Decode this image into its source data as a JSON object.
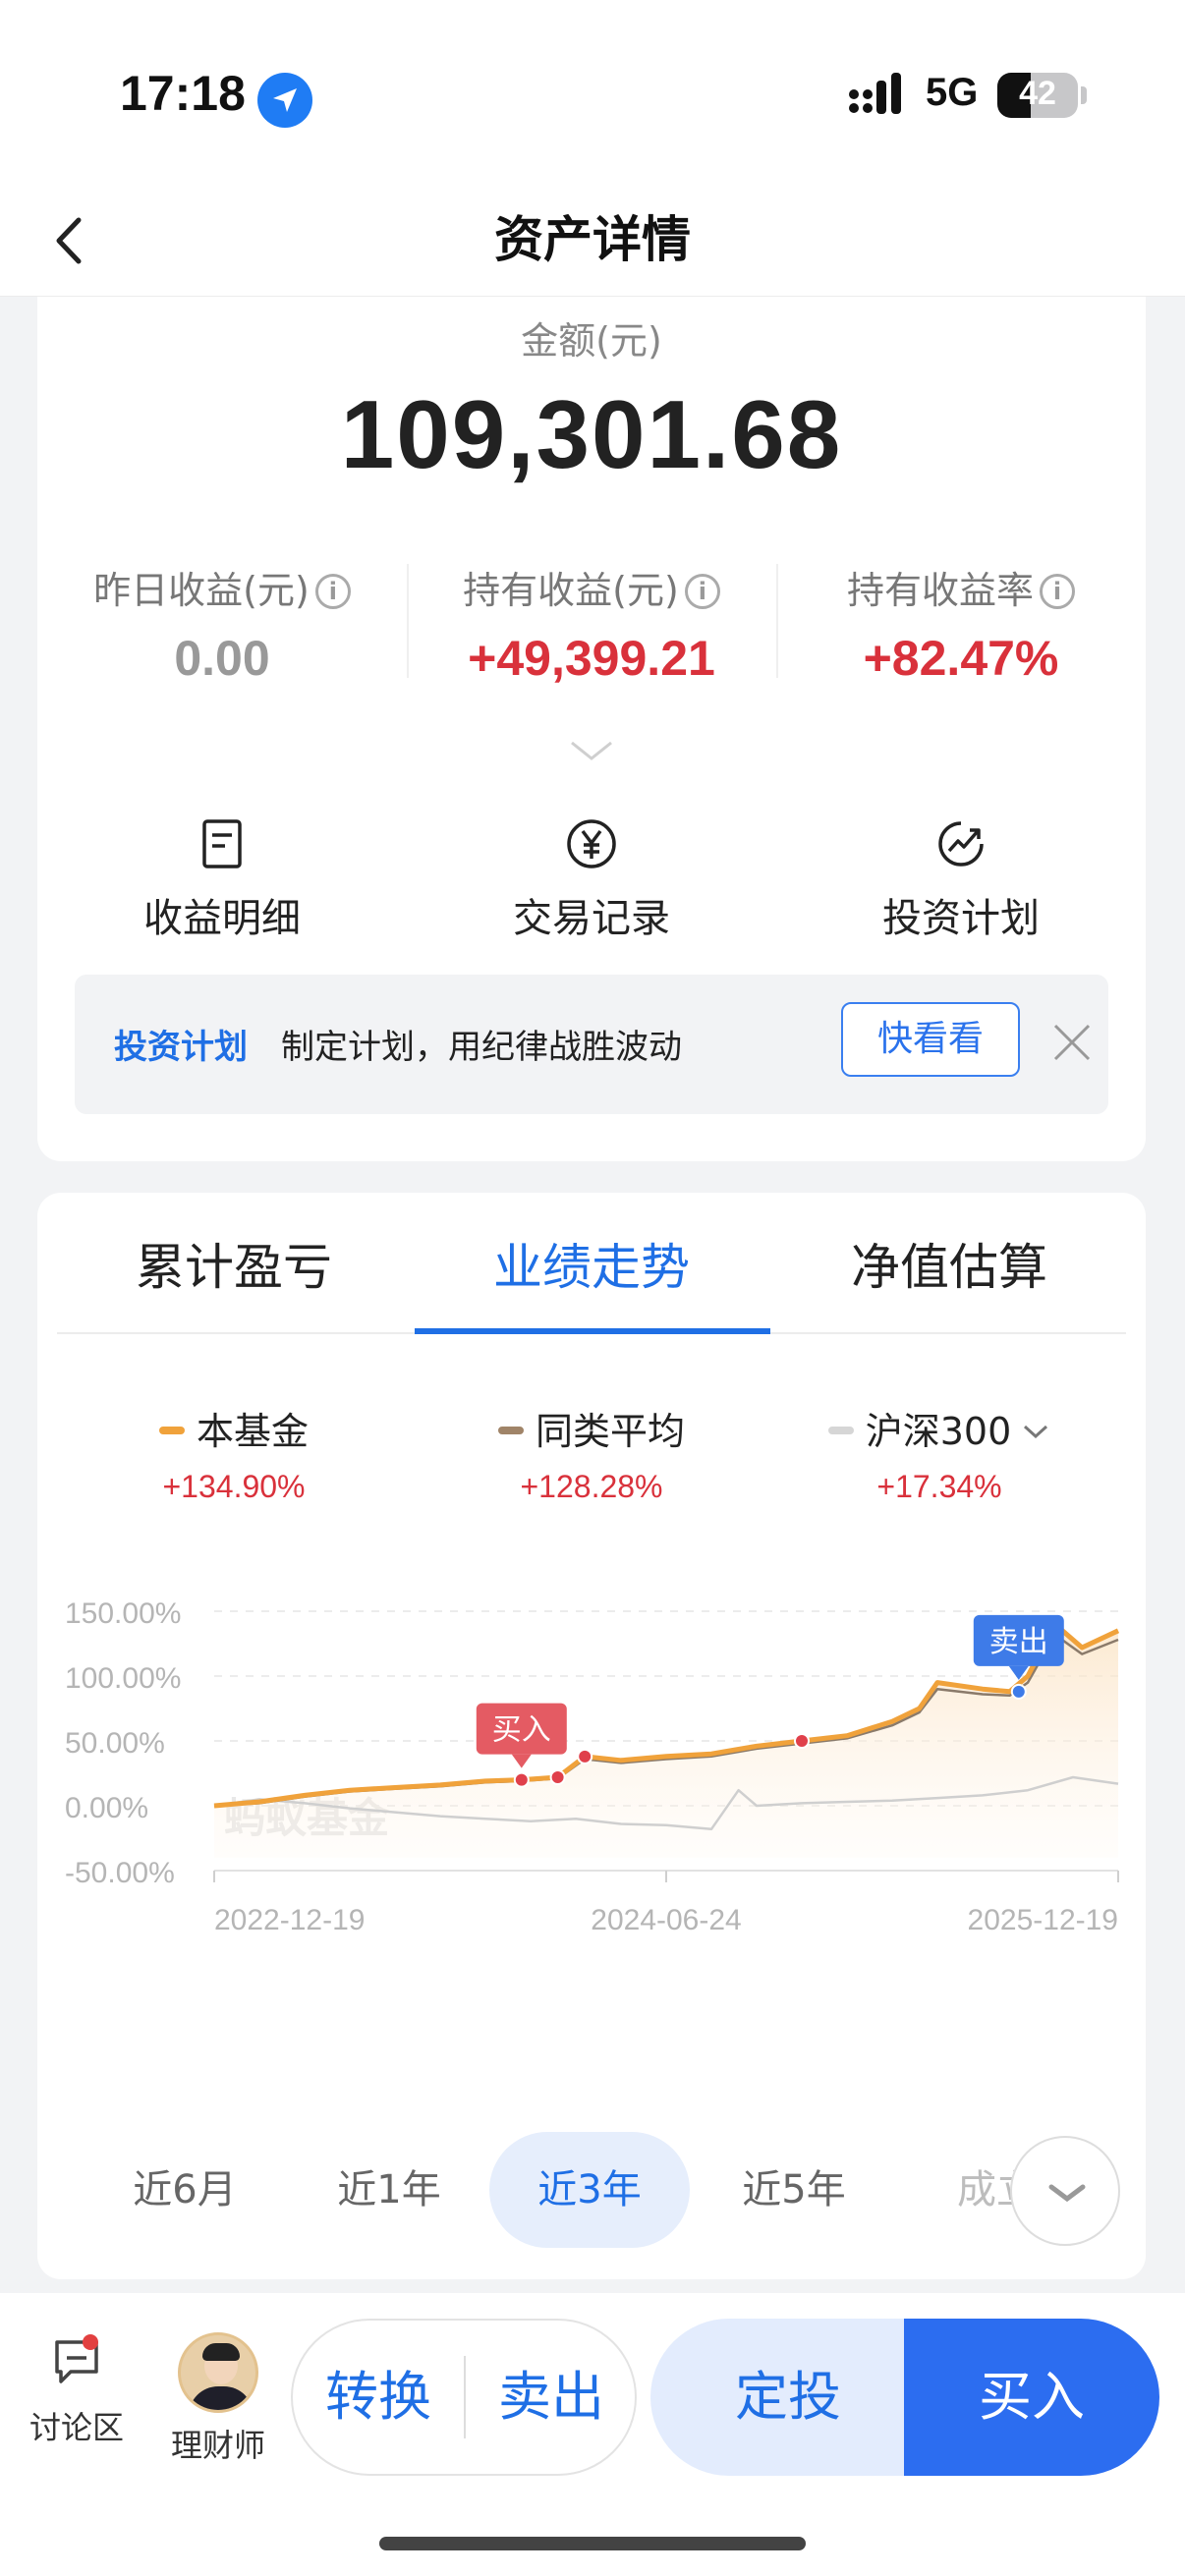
{
  "status_bar": {
    "time": "17:18",
    "network": "5G",
    "battery": "42"
  },
  "nav": {
    "title": "资产详情"
  },
  "asset": {
    "amount_label": "金额(元)",
    "amount_value": "109,301.68",
    "stats": [
      {
        "label": "昨日收益(元)",
        "value": "0.00"
      },
      {
        "label": "持有收益(元)",
        "value": "+49,399.21"
      },
      {
        "label": "持有收益率",
        "value": "+82.47%"
      }
    ]
  },
  "quick_actions": [
    {
      "label": "收益明细",
      "icon": "document-icon"
    },
    {
      "label": "交易记录",
      "icon": "yuan-circle-icon"
    },
    {
      "label": "投资计划",
      "icon": "growth-chart-icon"
    }
  ],
  "plan_banner": {
    "tag": "投资计划",
    "text": "制定计划，用纪律战胜波动",
    "button": "快看看"
  },
  "tabs": [
    {
      "label": "累计盈亏",
      "active": false
    },
    {
      "label": "业绩走势",
      "active": true
    },
    {
      "label": "净值估算",
      "active": false
    }
  ],
  "legend": [
    {
      "name": "本基金",
      "value": "+134.90%",
      "color": "#f0a23b"
    },
    {
      "name": "同类平均",
      "value": "+128.28%",
      "color": "#a08468"
    },
    {
      "name": "沪深300",
      "value": "+17.34%",
      "color": "#d6d6d6"
    }
  ],
  "chart_data": {
    "type": "line",
    "y_ticks": [
      "150.00%",
      "100.00%",
      "50.00%",
      "0.00%",
      "-50.00%"
    ],
    "ylim": [
      -50,
      150
    ],
    "x_ticks": [
      "2022-12-19",
      "2024-06-24",
      "2025-12-19"
    ],
    "watermark": "蚂蚁基金",
    "annotations": [
      {
        "label": "买入",
        "x": 0.34,
        "y": 20
      },
      {
        "label": "卖出",
        "x": 0.89,
        "y": 88
      }
    ],
    "series": [
      {
        "name": "本基金",
        "color": "#f0a23b",
        "x": [
          0,
          0.05,
          0.1,
          0.15,
          0.2,
          0.25,
          0.3,
          0.34,
          0.38,
          0.41,
          0.45,
          0.5,
          0.55,
          0.6,
          0.65,
          0.7,
          0.75,
          0.78,
          0.8,
          0.85,
          0.88,
          0.9,
          0.93,
          0.96,
          1.0
        ],
        "values": [
          0,
          3,
          8,
          12,
          14,
          16,
          19,
          20,
          22,
          38,
          35,
          38,
          40,
          46,
          50,
          54,
          65,
          75,
          95,
          90,
          88,
          100,
          140,
          122,
          135
        ]
      },
      {
        "name": "同类平均",
        "color": "#8a7a6a",
        "x": [
          0,
          0.05,
          0.1,
          0.15,
          0.2,
          0.25,
          0.3,
          0.34,
          0.38,
          0.41,
          0.45,
          0.5,
          0.55,
          0.6,
          0.65,
          0.7,
          0.75,
          0.78,
          0.8,
          0.85,
          0.88,
          0.9,
          0.93,
          0.96,
          1.0
        ],
        "values": [
          0,
          2,
          7,
          11,
          13,
          15,
          18,
          19,
          21,
          36,
          33,
          36,
          38,
          44,
          48,
          52,
          62,
          72,
          90,
          86,
          85,
          95,
          132,
          117,
          128
        ]
      },
      {
        "name": "沪深300",
        "color": "#cfcfcf",
        "x": [
          0,
          0.05,
          0.1,
          0.15,
          0.2,
          0.25,
          0.3,
          0.35,
          0.4,
          0.45,
          0.5,
          0.55,
          0.58,
          0.6,
          0.65,
          0.7,
          0.75,
          0.8,
          0.85,
          0.9,
          0.95,
          1.0
        ],
        "values": [
          0,
          5,
          2,
          -2,
          -5,
          -8,
          -10,
          -12,
          -10,
          -14,
          -15,
          -18,
          12,
          0,
          2,
          3,
          4,
          6,
          8,
          12,
          22,
          17
        ]
      }
    ]
  },
  "ranges": [
    {
      "label": "近6月",
      "active": false
    },
    {
      "label": "近1年",
      "active": false
    },
    {
      "label": "近3年",
      "active": true
    },
    {
      "label": "近5年",
      "active": false
    },
    {
      "label": "成立",
      "active": false
    }
  ],
  "bottom_bar": {
    "discussion": "讨论区",
    "advisor": "理财师",
    "convert": "转换",
    "sell": "卖出",
    "auto_invest": "定投",
    "buy": "买入"
  }
}
